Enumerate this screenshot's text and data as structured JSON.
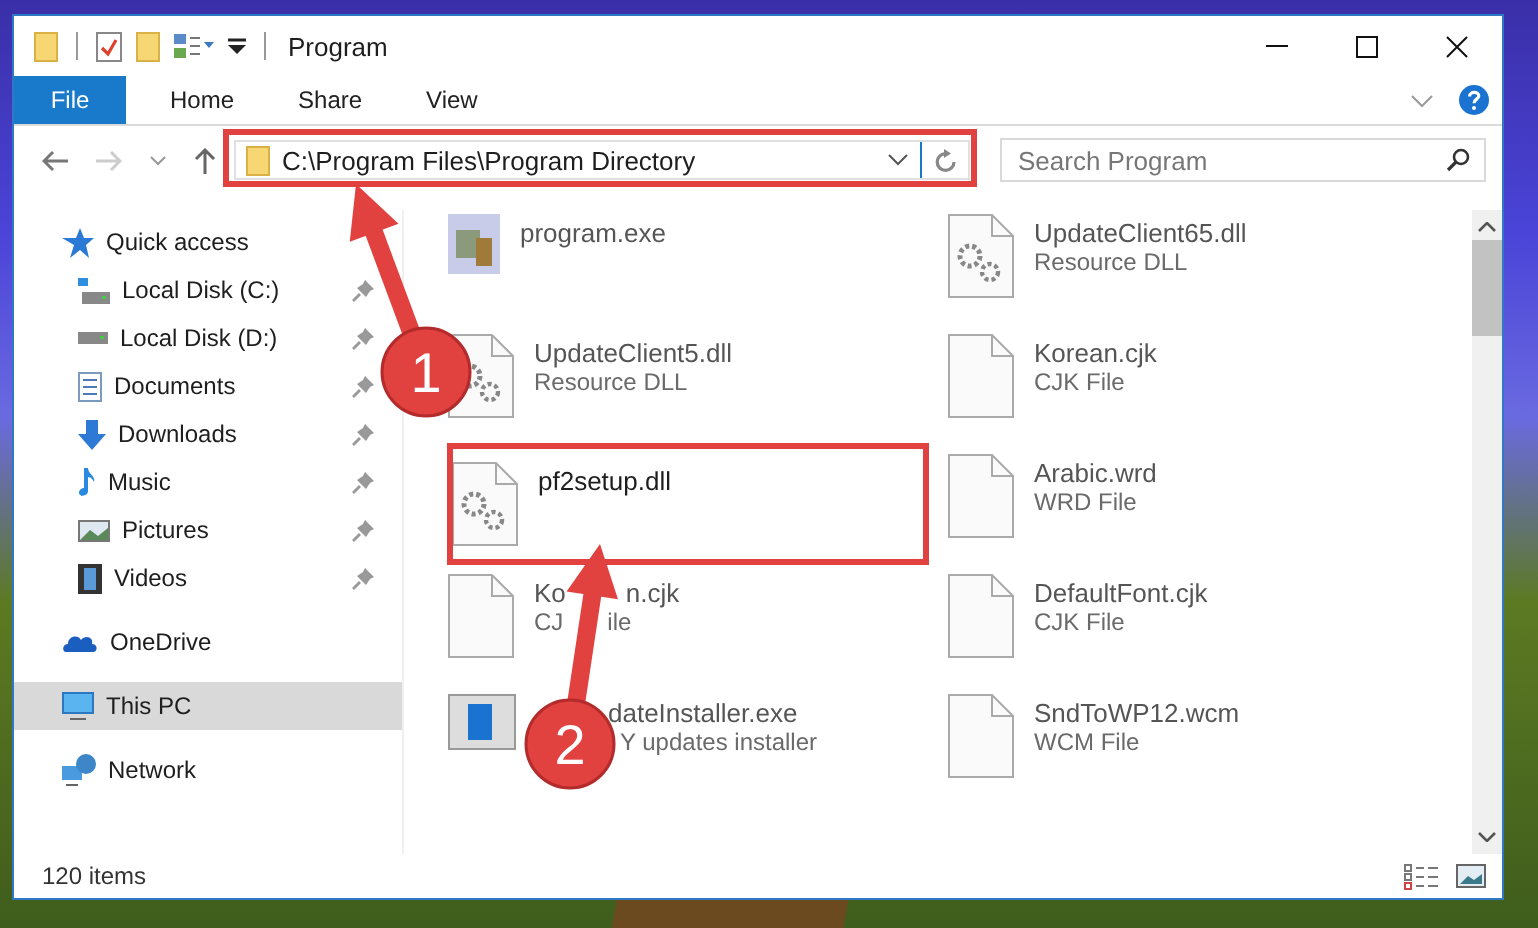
{
  "window": {
    "title": "Program"
  },
  "ribbon": {
    "tabs": [
      {
        "label": "File",
        "selected": true
      },
      {
        "label": "Home",
        "selected": false
      },
      {
        "label": "Share",
        "selected": false
      },
      {
        "label": "View",
        "selected": false
      }
    ]
  },
  "address": {
    "path": "C:\\Program Files\\Program Directory"
  },
  "search": {
    "placeholder": "Search Program"
  },
  "nav": [
    {
      "label": "Quick access",
      "selected": false,
      "children": [
        {
          "label": "Local Disk (C:)",
          "selected": false
        },
        {
          "label": "Local Disk (D:)",
          "selected": false
        },
        {
          "label": "Documents",
          "selected": false
        },
        {
          "label": "Downloads",
          "selected": false
        },
        {
          "label": "Music",
          "selected": false
        },
        {
          "label": "Pictures",
          "selected": false
        },
        {
          "label": "Videos",
          "selected": false
        }
      ]
    },
    {
      "label": "OneDrive",
      "selected": false
    },
    {
      "label": "This PC",
      "selected": true
    },
    {
      "label": "Network",
      "selected": false
    }
  ],
  "files": [
    {
      "name": "program.exe",
      "kind": "exe"
    },
    {
      "name": "UpdateClient65.dll",
      "type": "Resource DLL",
      "kind": "dll"
    },
    {
      "name": "UpdateClient5.dll",
      "type": "Resource DLL",
      "kind": "dll"
    },
    {
      "name": "Korean.cjk",
      "type": "CJK File",
      "kind": "blank"
    },
    {
      "name": "pf2setup.dll",
      "kind": "dll"
    },
    {
      "name": "Arabic.wrd",
      "type": "WRD File",
      "kind": "blank"
    },
    {
      "name_parts": [
        "Ko",
        "n.cjk"
      ],
      "type_parts": [
        "CJ",
        "ile"
      ],
      "kind": "blank"
    },
    {
      "name": "DefaultFont.cjk",
      "type": "CJK File",
      "kind": "blank"
    },
    {
      "name": "dateInstaller.exe",
      "type": "Y updates installer",
      "kind": "installer"
    },
    {
      "name": "SndToWP12.wcm",
      "type": "WCM File",
      "kind": "blank"
    }
  ],
  "status_bar": {
    "count": "120 items"
  },
  "callouts": [
    {
      "label": "1"
    },
    {
      "label": "2"
    }
  ]
}
